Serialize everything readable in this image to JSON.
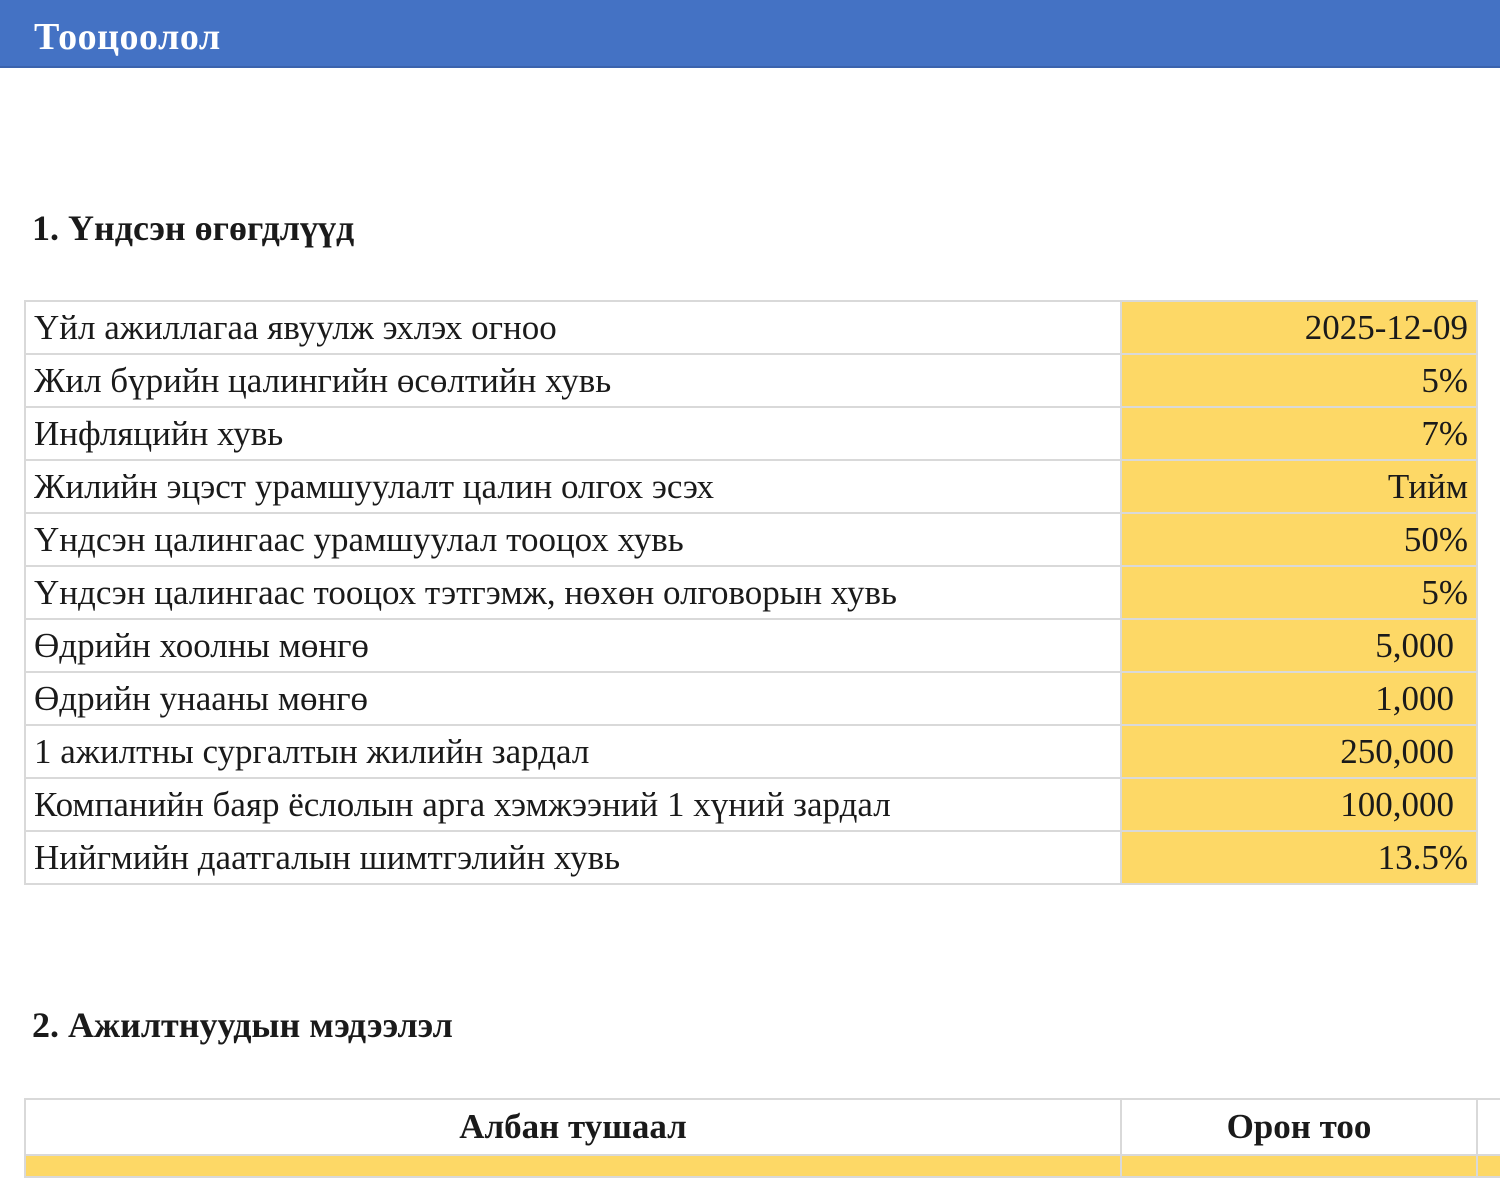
{
  "header": {
    "title": "Тооцоолол",
    "color": "#4472c4"
  },
  "sections": {
    "basic": {
      "heading": "1. Үндсэн өгөгдлүүд",
      "rows": [
        {
          "label": "Үйл ажиллагаа явуулж эхлэх огноо",
          "value": "2025-12-09"
        },
        {
          "label": "Жил бүрийн цалингийн өсөлтийн хувь",
          "value": "5%"
        },
        {
          "label": "Инфляцийн хувь",
          "value": "7%"
        },
        {
          "label": "Жилийн эцэст урамшуулалт цалин олгох эсэх",
          "value": "Тийм"
        },
        {
          "label": "Үндсэн цалингаас урамшуулал тооцох хувь",
          "value": "50%"
        },
        {
          "label": "Үндсэн цалингаас тооцох тэтгэмж, нөхөн олговорын хувь",
          "value": "5%"
        },
        {
          "label": "Өдрийн хоолны мөнгө",
          "value": "5,000"
        },
        {
          "label": "Өдрийн унааны мөнгө",
          "value": "1,000"
        },
        {
          "label": "1 ажилтны сургалтын жилийн зардал",
          "value": "250,000"
        },
        {
          "label": "Компанийн баяр ёслолын арга хэмжээний 1 хүний зардал",
          "value": "100,000"
        },
        {
          "label": "Нийгмийн даатгалын шимтгэлийн хувь",
          "value": "13.5%"
        }
      ],
      "input_color": "#fdd866"
    },
    "staff": {
      "heading": "2. Ажилтнуудын мэдээлэл",
      "columns": [
        "Албан тушаал",
        "Орон тоо"
      ]
    }
  }
}
